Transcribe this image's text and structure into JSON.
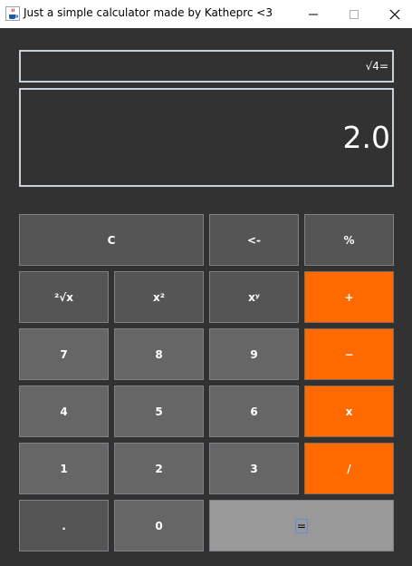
{
  "window": {
    "title": "Just a simple calculator made by Katheprc <3",
    "icon": "java-coffee-cup-icon"
  },
  "display": {
    "expression": "√4=",
    "result": "2.0"
  },
  "buttons": {
    "clear": "C",
    "backspace": "<-",
    "percent": "%",
    "root": "²√x",
    "square": "x²",
    "power": "xʸ",
    "add": "+",
    "seven": "7",
    "eight": "8",
    "nine": "9",
    "subtract": "−",
    "four": "4",
    "five": "5",
    "six": "6",
    "multiply": "x",
    "one": "1",
    "two": "2",
    "three": "3",
    "divide": "/",
    "decimal": ".",
    "zero": "0",
    "equals": "="
  },
  "colors": {
    "background": "#323232",
    "button_dark": "#555555",
    "button_mid": "#666666",
    "operator": "#ff6a00",
    "equals": "#999999"
  }
}
